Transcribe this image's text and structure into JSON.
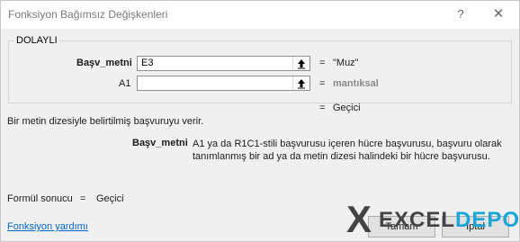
{
  "dialog": {
    "title": "Fonksiyon Bağımsız Değişkenleri",
    "help_glyph": "?",
    "close_glyph": "✕"
  },
  "group": {
    "name": "DOLAYLI",
    "args": [
      {
        "label": "Başv_metni",
        "value": "E3",
        "eq": "=",
        "result": "\"Muz\""
      },
      {
        "label": "A1",
        "value": "",
        "eq": "=",
        "result": "mantıksal"
      }
    ]
  },
  "result_row": {
    "eq": "=",
    "value": "Geçici"
  },
  "description": "Bir metin dizesiyle belirtilmiş başvuruyu verir.",
  "arg_help": {
    "name": "Başv_metni",
    "text": "A1 ya da R1C1-stili başvurusu içeren hücre başvurusu, başvuru olarak tanımlanmış bir ad ya da metin dizesi halindeki bir hücre başvurusu."
  },
  "formula_result": {
    "label": "Formül sonucu",
    "eq": "=",
    "value": "Geçici"
  },
  "help_link": "Fonksiyon yardımı",
  "buttons": {
    "ok": "Tamam",
    "cancel": "İptal"
  },
  "watermark": {
    "excel": "EXCEL",
    "depo": "DEPO"
  },
  "colors": {
    "accent": "#19a6d8",
    "link": "#0066cc",
    "dialog_bg": "#f0f0f0"
  }
}
